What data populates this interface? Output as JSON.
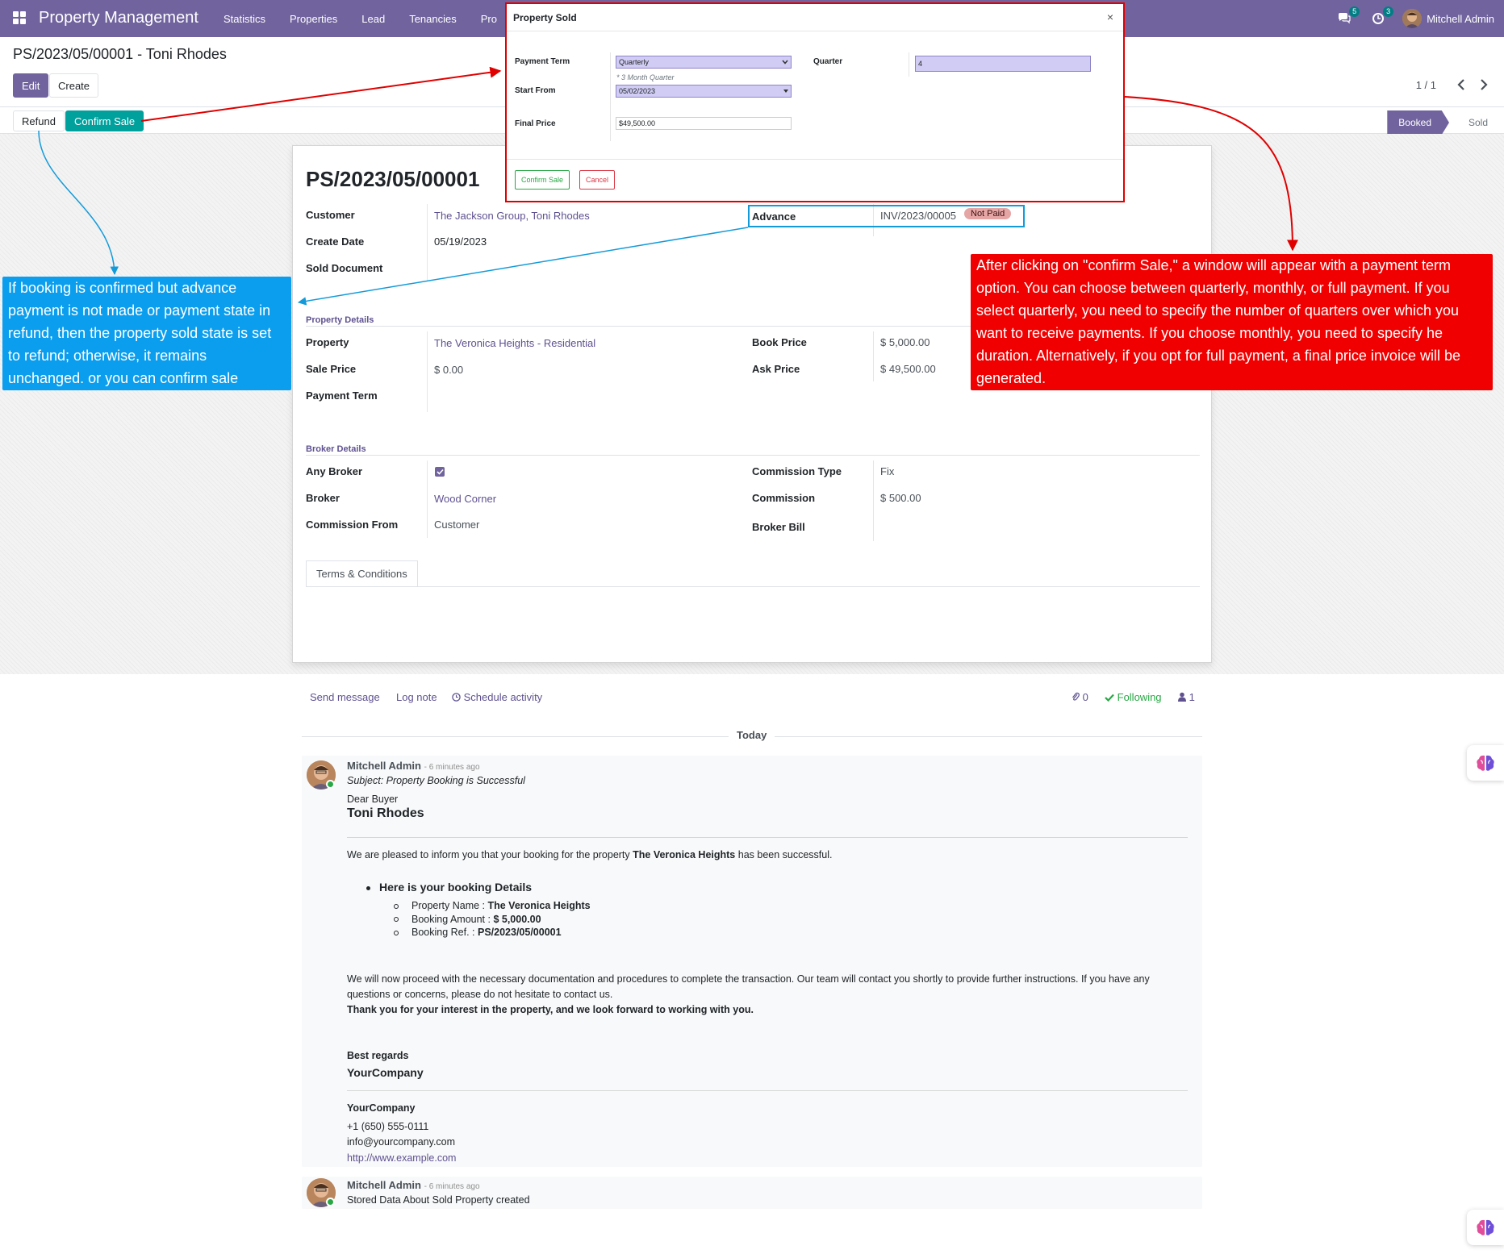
{
  "navbar": {
    "brand": "Property Management",
    "menu": [
      "Statistics",
      "Properties",
      "Lead",
      "Tenancies",
      "Pro"
    ],
    "chat_count": "5",
    "activity_count": "3",
    "user_name": "Mitchell Admin"
  },
  "control": {
    "breadcrumb": "PS/2023/05/00001 - Toni Rhodes",
    "edit_label": "Edit",
    "create_label": "Create",
    "pager": "1 / 1",
    "refund_label": "Refund",
    "confirm_sale_label": "Confirm Sale",
    "stages": [
      "Booked",
      "Sold"
    ]
  },
  "form": {
    "title": "PS/2023/05/00001",
    "labels": {
      "customer": "Customer",
      "create_date": "Create Date",
      "sold_document": "Sold Document",
      "advance": "Advance",
      "property_details": "Property Details",
      "property": "Property",
      "sale_price": "Sale Price",
      "payment_term": "Payment Term",
      "book_price": "Book Price",
      "ask_price": "Ask Price",
      "broker_details": "Broker Details",
      "any_broker": "Any Broker",
      "broker": "Broker",
      "commission_from": "Commission From",
      "commission_type": "Commission Type",
      "commission": "Commission",
      "broker_bill": "Broker Bill"
    },
    "values": {
      "customer": "The Jackson Group, Toni Rhodes",
      "create_date": "05/19/2023",
      "advance_invoice": "INV/2023/00005",
      "advance_status": "Not Paid",
      "property": "The Veronica Heights - Residential",
      "sale_price": "$ 0.00",
      "book_price": "$ 5,000.00",
      "ask_price": "$ 49,500.00",
      "any_broker": true,
      "broker": "Wood Corner",
      "commission_from": "Customer",
      "commission_type": "Fix",
      "commission": "$ 500.00"
    },
    "tab": "Terms & Conditions"
  },
  "modal": {
    "title": "Property Sold",
    "close": "×",
    "payment_term_label": "Payment Term",
    "payment_term_value": "Quarterly",
    "payment_term_hint": "* 3 Month Quarter",
    "start_from_label": "Start From",
    "start_from_value": "05/02/2023",
    "final_price_label": "Final Price",
    "final_price_value": "$49,500.00",
    "quarter_label": "Quarter",
    "quarter_value": "4",
    "confirm_label": "Confirm Sale",
    "cancel_label": "Cancel"
  },
  "annotations": {
    "blue": "If booking is confirmed but advance payment is not made or payment state in refund, then the property sold state is set to refund; otherwise, it remains unchanged. or you can confirm sale",
    "red": "After clicking on \"confirm Sale,\" a window will appear with a payment term option. You can choose between quarterly, monthly, or full payment. If you select quarterly, you need to specify the number of quarters over which you want to receive payments. If you choose monthly, you need to specify he duration. Alternatively, if you opt for full payment, a final price invoice will be generated."
  },
  "chatter": {
    "send_message": "Send message",
    "log_note": "Log note",
    "schedule_activity": "Schedule activity",
    "attachments": "0",
    "following": "Following",
    "followers": "1",
    "today": "Today",
    "message1": {
      "author": "Mitchell Admin",
      "ago": "- 6 minutes ago",
      "subject": "Subject: Property Booking is Successful",
      "greeting": "Dear Buyer",
      "name": "Toni Rhodes",
      "intro_pre": "We are pleased to inform you that your booking for the property ",
      "intro_property": "The Veronica Heights",
      "intro_post": " has been successful.",
      "details_heading": "Here is your booking Details",
      "details": [
        {
          "label": "Property Name : ",
          "value": "The Veronica Heights"
        },
        {
          "label": "Booking Amount : ",
          "value": "$ 5,000.00"
        },
        {
          "label": "Booking Ref. : ",
          "value": "PS/2023/05/00001"
        }
      ],
      "body_line1": "We will now proceed with the necessary documentation and procedures to complete the transaction. Our team will contact you shortly to provide further instructions. If you have any",
      "body_line2": "questions or concerns, please do not hesitate to contact us.",
      "thanks": "Thank you for your interest in the property, and we look forward to working with you.",
      "regards": "Best regards",
      "company": "YourCompany",
      "sig_company": "YourCompany",
      "phone": "+1 (650) 555-0111",
      "email": "info@yourcompany.com",
      "website": "http://www.example.com"
    },
    "message2": {
      "author": "Mitchell Admin",
      "ago": "- 6 minutes ago",
      "body": "Stored Data About Sold Property created"
    }
  },
  "colors": {
    "brand": "#71639e",
    "accent": "#00a09d",
    "annotation_blue": "#0b9eee",
    "annotation_red": "#f00000"
  }
}
